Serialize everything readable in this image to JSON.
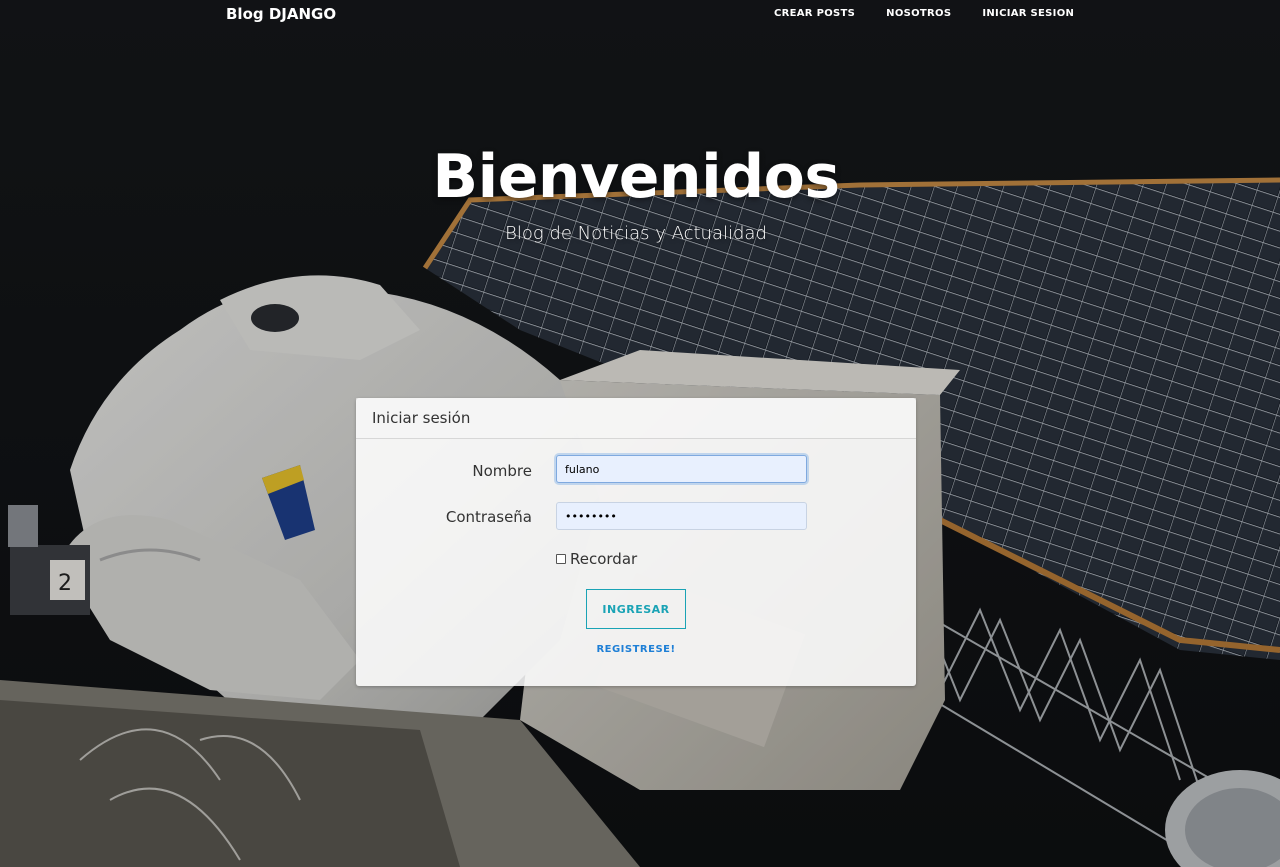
{
  "navbar": {
    "brand": "Blog DJANGO",
    "links": [
      "CREAR POSTS",
      "NOSOTROS",
      "INICIAR SESION"
    ]
  },
  "hero": {
    "title": "Bienvenidos",
    "subtitle": "Blog de Noticias y Actualidad"
  },
  "login": {
    "header": "Iniciar sesión",
    "username_label": "Nombre",
    "username_value": "fulano",
    "password_label": "Contraseña",
    "password_value": "secreto1",
    "remember_label": "Recordar",
    "remember_checked": false,
    "submit_label": "INGRESAR",
    "register_label": "REGISTRESE!"
  },
  "colors": {
    "accent_button": "#1aa3b5",
    "link": "#1e7fd6",
    "input_bg": "#e8f0fe"
  }
}
